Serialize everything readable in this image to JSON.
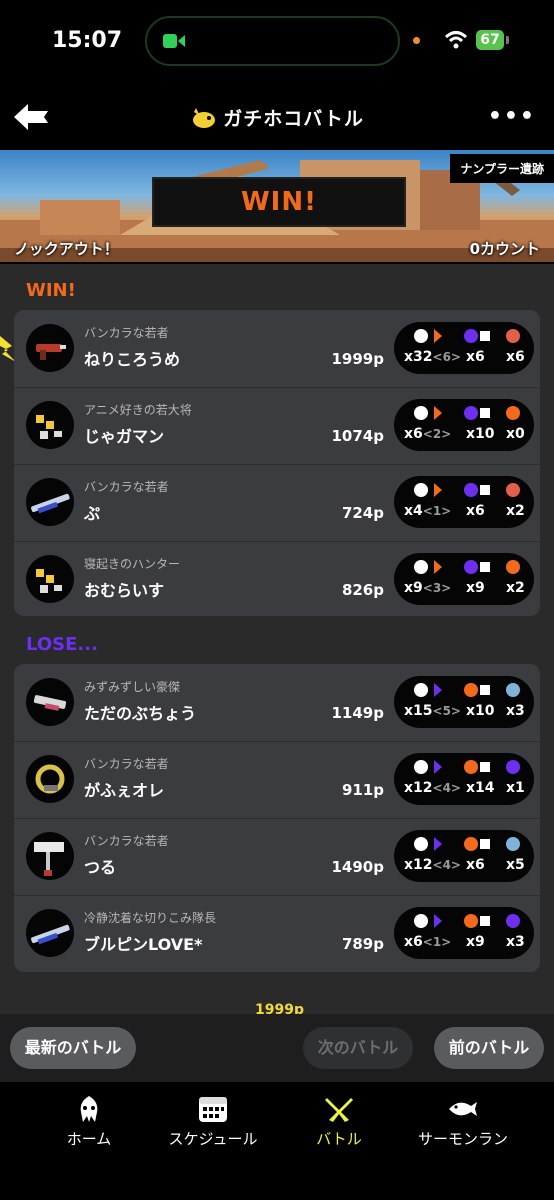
{
  "status_bar": {
    "time": "15:07",
    "battery": "67"
  },
  "header": {
    "title": "ガチホコバトル",
    "more": "•••"
  },
  "banner": {
    "stage": "ナンプラー遺跡",
    "result": "WIN!",
    "knockout": "ノックアウト！",
    "count": "0カウント"
  },
  "colors": {
    "win": "#f36a1d",
    "lose": "#6d2ff0",
    "accent": "#e9f542"
  },
  "win_team": {
    "label": "WIN!",
    "players": [
      {
        "title": "バンカラな若者",
        "name": "ねりころうめ",
        "points": "1999p",
        "kills": "x32",
        "assists": "<6>",
        "deaths": "x6",
        "specials": "x6"
      },
      {
        "title": "アニメ好きの若大将",
        "name": "じゃガマン",
        "points": "1074p",
        "kills": "x6",
        "assists": "<2>",
        "deaths": "x10",
        "specials": "x0"
      },
      {
        "title": "バンカラな若者",
        "name": "ぷ",
        "points": "724p",
        "kills": "x4",
        "assists": "<1>",
        "deaths": "x6",
        "specials": "x2"
      },
      {
        "title": "寝起きのハンター",
        "name": "おむらいす",
        "points": "826p",
        "kills": "x9",
        "assists": "<3>",
        "deaths": "x9",
        "specials": "x2"
      }
    ]
  },
  "lose_team": {
    "label": "LOSE...",
    "players": [
      {
        "title": "みずみずしい豪傑",
        "name": "ただのぶちょう",
        "points": "1149p",
        "kills": "x15",
        "assists": "<5>",
        "deaths": "x10",
        "specials": "x3"
      },
      {
        "title": "バンカラな若者",
        "name": "がふぇオレ",
        "points": "911p",
        "kills": "x12",
        "assists": "<4>",
        "deaths": "x14",
        "specials": "x1"
      },
      {
        "title": "バンカラな若者",
        "name": "つる",
        "points": "1490p",
        "kills": "x12",
        "assists": "<4>",
        "deaths": "x6",
        "specials": "x5"
      },
      {
        "title": "冷静沈着な切りこみ隊長",
        "name": "ブルピンLOVE*",
        "points": "789p",
        "kills": "x6",
        "assists": "<1>",
        "deaths": "x9",
        "specials": "x3"
      }
    ]
  },
  "peek_text": "1999p",
  "actions": {
    "latest": "最新のバトル",
    "next": "次のバトル",
    "prev": "前のバトル"
  },
  "tabs": [
    {
      "label": "ホーム",
      "icon": "squid-icon"
    },
    {
      "label": "スケジュール",
      "icon": "calendar-icon"
    },
    {
      "label": "バトル",
      "icon": "crossed-weapons-icon"
    },
    {
      "label": "サーモンラン",
      "icon": "salmon-icon"
    }
  ]
}
